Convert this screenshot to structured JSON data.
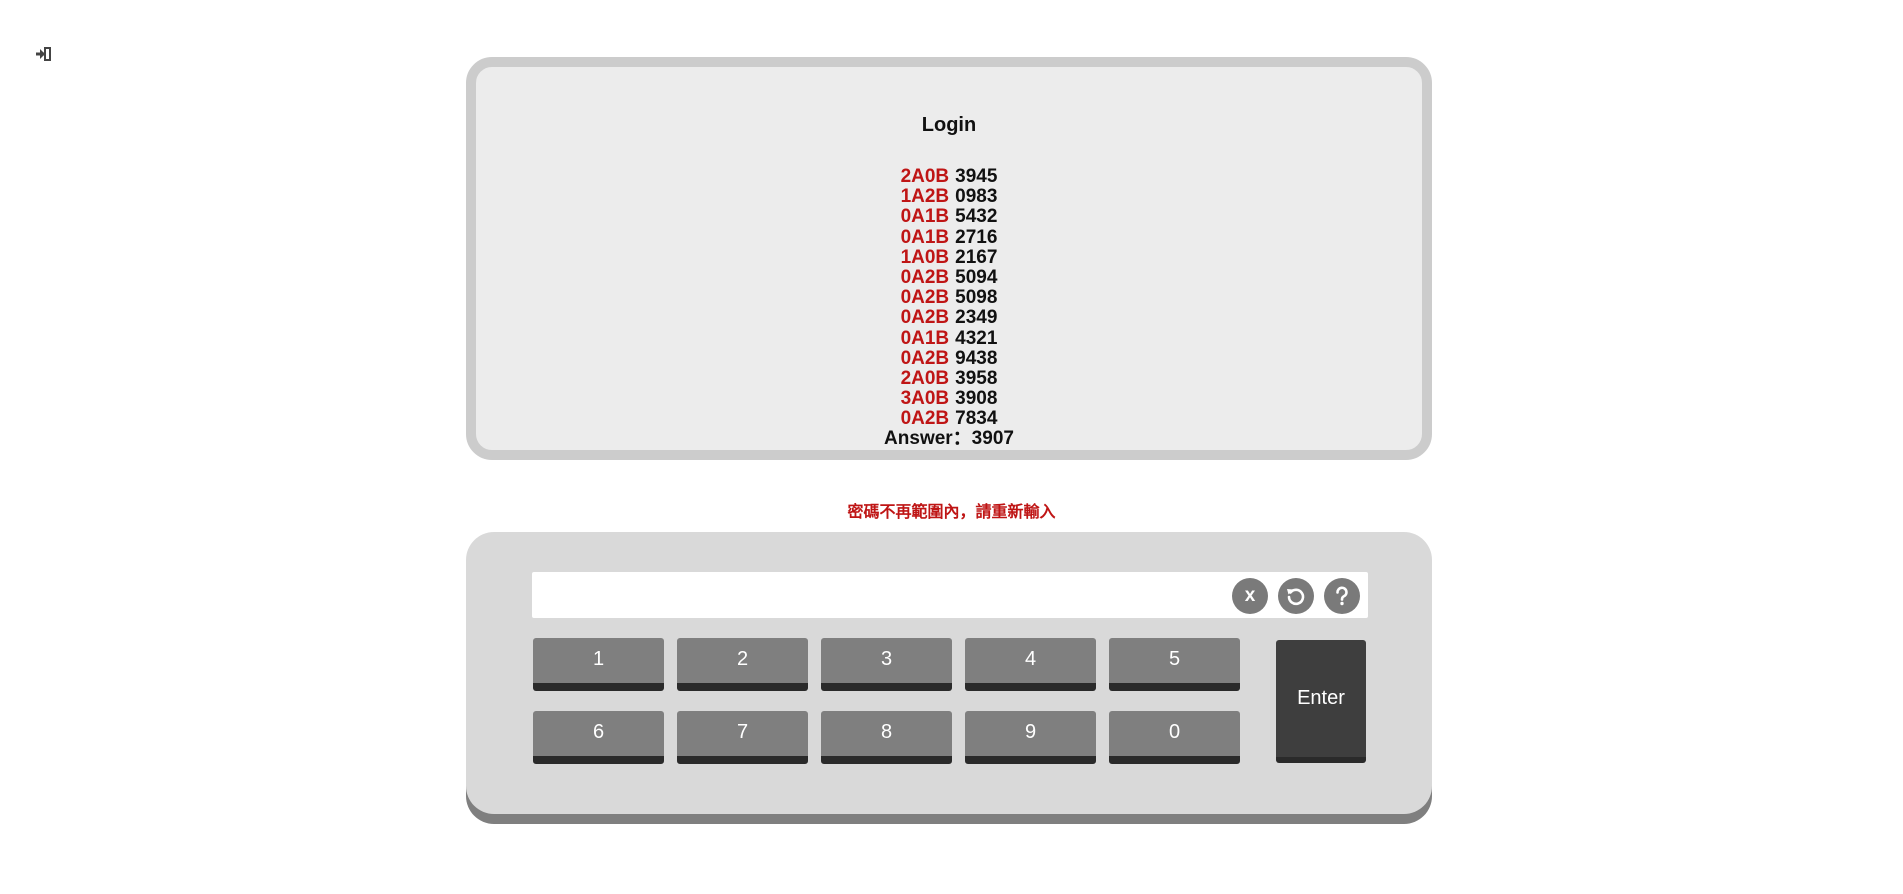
{
  "toolbar": {
    "logout_icon": "sign-in-arrow-icon"
  },
  "display": {
    "title": "Login",
    "guesses": [
      {
        "result": "2A0B",
        "number": "3945"
      },
      {
        "result": "1A2B",
        "number": "0983"
      },
      {
        "result": "0A1B",
        "number": "5432"
      },
      {
        "result": "0A1B",
        "number": "2716"
      },
      {
        "result": "1A0B",
        "number": "2167"
      },
      {
        "result": "0A2B",
        "number": "5094"
      },
      {
        "result": "0A2B",
        "number": "5098"
      },
      {
        "result": "0A2B",
        "number": "2349"
      },
      {
        "result": "0A1B",
        "number": "4321"
      },
      {
        "result": "0A2B",
        "number": "9438"
      },
      {
        "result": "2A0B",
        "number": "3958"
      },
      {
        "result": "3A0B",
        "number": "3908"
      },
      {
        "result": "0A2B",
        "number": "7834"
      }
    ],
    "answer": "Answer：3907"
  },
  "message": {
    "error": "密碼不再範圍內，請重新輸入"
  },
  "keypad": {
    "input_value": "",
    "clear_label": "x",
    "reset_icon": "undo-icon",
    "help_icon": "question-mark-icon",
    "keys_row1": [
      "1",
      "2",
      "3",
      "4",
      "5"
    ],
    "keys_row2": [
      "6",
      "7",
      "8",
      "9",
      "0"
    ],
    "enter_label": "Enter"
  },
  "colors": {
    "result_red": "#bf1515",
    "panel_bg": "#ececec",
    "panel_border": "#cccccc",
    "keypad_bg": "#d9d9d9",
    "key_bg": "#7f7f7f",
    "enter_bg": "#3e3e3e",
    "icon_btn_bg": "#7a7a7a"
  }
}
